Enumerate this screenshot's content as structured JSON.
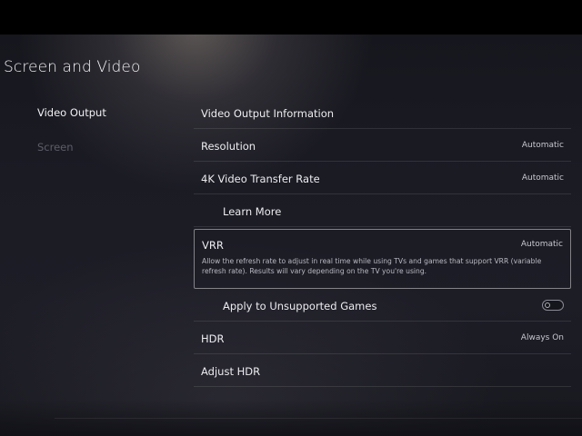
{
  "page": {
    "title": "Screen and Video"
  },
  "sidebar": {
    "items": [
      {
        "label": "Video Output"
      },
      {
        "label": "Screen"
      }
    ]
  },
  "settings": {
    "video_output_info": {
      "label": "Video Output Information"
    },
    "resolution": {
      "label": "Resolution",
      "value": "Automatic"
    },
    "transfer_rate": {
      "label": "4K Video Transfer Rate",
      "value": "Automatic"
    },
    "learn_more": {
      "label": "Learn More"
    },
    "vrr": {
      "label": "VRR",
      "value": "Automatic",
      "description": "Allow the refresh rate to adjust in real time while using TVs and games that support VRR (variable refresh rate). Results will vary depending on the TV you're using."
    },
    "unsupported_games": {
      "label": "Apply to Unsupported Games",
      "toggle": "off"
    },
    "hdr": {
      "label": "HDR",
      "value": "Always On"
    },
    "adjust_hdr": {
      "label": "Adjust HDR"
    }
  },
  "icons": [
    "toggle-switch-icon"
  ]
}
